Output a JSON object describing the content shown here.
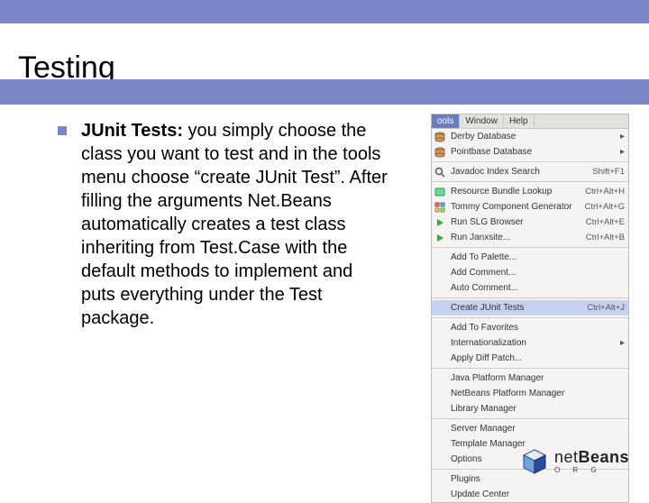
{
  "slide": {
    "title": "Testing",
    "bullet_label": "JUnit Tests:",
    "bullet_body": " you simply choose the class you want to test and in the tools menu choose “create JUnit Test”. After filling the arguments Net.Beans automatically creates a test class inheriting from Test.Case with the default methods to implement and puts everything under the Test package."
  },
  "menu": {
    "tabs": {
      "active": "ools",
      "inactive1": "Window",
      "inactive2": "Help"
    },
    "groups": [
      {
        "items": [
          {
            "icon": "db-icon",
            "label": "Derby Database",
            "shortcut": "",
            "sub": true
          },
          {
            "icon": "db-icon",
            "label": "Pointbase Database",
            "shortcut": "",
            "sub": true
          }
        ]
      },
      {
        "items": [
          {
            "icon": "search-icon",
            "label": "Javadoc Index Search",
            "shortcut": "Shift+F1",
            "sub": false
          }
        ]
      },
      {
        "items": [
          {
            "icon": "bundle-icon",
            "label": "Resource Bundle Lookup",
            "shortcut": "Ctrl+Alt+H",
            "sub": false
          },
          {
            "icon": "component-icon",
            "label": "Tommy Component Generator",
            "shortcut": "Ctrl+Alt+G",
            "sub": false
          },
          {
            "icon": "run-icon",
            "label": "Run SLG Browser",
            "shortcut": "Ctrl+Alt+E",
            "sub": false
          },
          {
            "icon": "run-icon",
            "label": "Run Janxsite...",
            "shortcut": "Ctrl+Alt+B",
            "sub": false
          }
        ]
      },
      {
        "items": [
          {
            "icon": "blank-icon",
            "label": "Add To Palette...",
            "shortcut": "",
            "sub": false
          },
          {
            "icon": "blank-icon",
            "label": "Add Comment...",
            "shortcut": "",
            "sub": false
          },
          {
            "icon": "blank-icon",
            "label": "Auto Comment...",
            "shortcut": "",
            "sub": false
          }
        ]
      },
      {
        "items": [
          {
            "icon": "blank-icon",
            "label": "Create JUnit Tests",
            "shortcut": "Ctrl+Alt+J",
            "sub": false,
            "highlight": true
          }
        ]
      },
      {
        "items": [
          {
            "icon": "blank-icon",
            "label": "Add To Favorites",
            "shortcut": "",
            "sub": false
          },
          {
            "icon": "blank-icon",
            "label": "Internationalization",
            "shortcut": "",
            "sub": true
          },
          {
            "icon": "blank-icon",
            "label": "Apply Diff Patch...",
            "shortcut": "",
            "sub": false
          }
        ]
      },
      {
        "items": [
          {
            "icon": "blank-icon",
            "label": "Java Platform Manager",
            "shortcut": "",
            "sub": false
          },
          {
            "icon": "blank-icon",
            "label": "NetBeans Platform Manager",
            "shortcut": "",
            "sub": false
          },
          {
            "icon": "blank-icon",
            "label": "Library Manager",
            "shortcut": "",
            "sub": false
          }
        ]
      },
      {
        "items": [
          {
            "icon": "blank-icon",
            "label": "Server Manager",
            "shortcut": "",
            "sub": false
          },
          {
            "icon": "blank-icon",
            "label": "Template Manager",
            "shortcut": "",
            "sub": false
          },
          {
            "icon": "blank-icon",
            "label": "Options",
            "shortcut": "",
            "sub": false
          }
        ]
      },
      {
        "items": [
          {
            "icon": "blank-icon",
            "label": "Plugins",
            "shortcut": "",
            "sub": false
          },
          {
            "icon": "blank-icon",
            "label": "Update Center",
            "shortcut": "",
            "sub": false
          }
        ]
      }
    ]
  },
  "footer": {
    "brand_plain": "net",
    "brand_bold": "Beans",
    "site": "O R G"
  }
}
